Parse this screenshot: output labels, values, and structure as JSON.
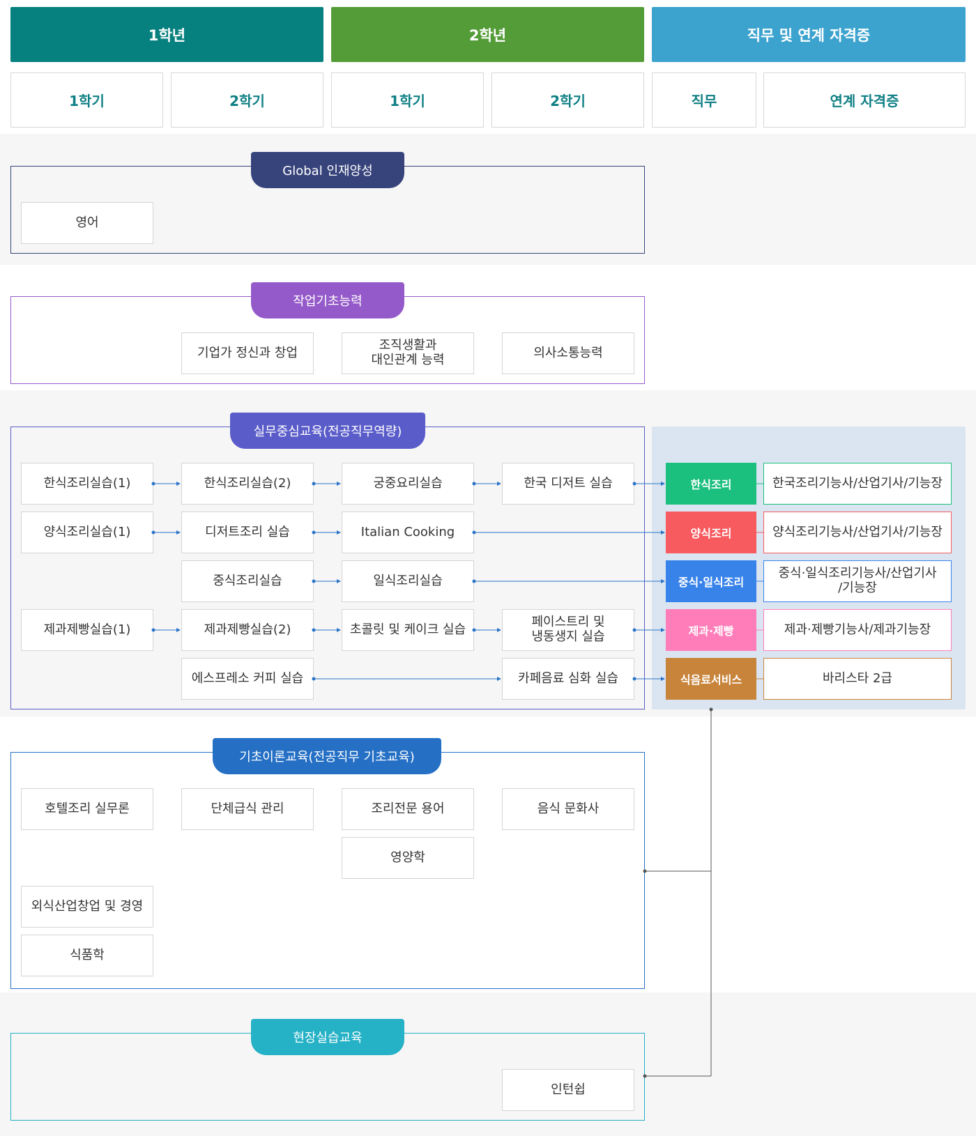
{
  "colors": {
    "year1": "#07817f",
    "year2": "#549c38",
    "jobs_header": "#3ca3cf",
    "global": "#37447b",
    "basic_ability": "#955ac9",
    "practical": "#5a5cc9",
    "theory": "#2570c5",
    "field": "#25b1c6",
    "korean": "#1bbf7e",
    "western": "#f75a5f",
    "chinese_japanese": "#3883ea",
    "bakery": "#ff7eb9",
    "food_service": "#c8843b",
    "jobs_panel": "#dbe4f1",
    "connector": "#2a74c9"
  },
  "headers": {
    "year1": "1학년",
    "year2": "2학년",
    "jobs": "직무 및 연계 자격증"
  },
  "subheaders": {
    "y1_sem1": "1학기",
    "y1_sem2": "2학기",
    "y2_sem1": "1학기",
    "y2_sem2": "2학기",
    "job": "직무",
    "cert": "연계 자격증"
  },
  "sections": {
    "global": {
      "title": "Global 인재양성",
      "courses": {
        "english": "영어"
      }
    },
    "basic_ability": {
      "title": "작업기초능력",
      "courses": {
        "entrepreneur": "기업가 정신과 창업",
        "organization": "조직생활과\n대인관계 능력",
        "communication": "의사소통능력"
      }
    },
    "practical": {
      "title": "실무중심교육(전공직무역량)",
      "courses": {
        "korean1": "한식조리실습(1)",
        "korean2": "한식조리실습(2)",
        "royal": "궁중요리실습",
        "korean_dessert": "한국 디저트 실습",
        "western1": "양식조리실습(1)",
        "dessert_cooking": "디저트조리 실습",
        "italian": "Italian Cooking",
        "chinese": "중식조리실습",
        "japanese": "일식조리실습",
        "bakery1": "제과제빵실습(1)",
        "bakery2": "제과제빵실습(2)",
        "chocolate": "초콜릿 및 케이크 실습",
        "pastry": "페이스트리 및\n냉동생지 실습",
        "espresso": "에스프레소 커피 실습",
        "cafe": "카페음료 심화 실습"
      }
    },
    "theory": {
      "title": "기초이론교육(전공직무 기초교육)",
      "courses": {
        "hotel": "호텔조리 실무론",
        "group_meal": "단체급식 관리",
        "terminology": "조리전문 용어",
        "food_culture": "음식 문화사",
        "nutrition": "영양학",
        "startup": "외식산업창업 및 경영",
        "food_science": "식품학"
      }
    },
    "field": {
      "title": "현장실습교육",
      "courses": {
        "intern": "인턴쉽"
      }
    }
  },
  "jobs": [
    {
      "name": "한식조리",
      "cert": "한국조리기능사/산업기사/기능장",
      "color_key": "korean"
    },
    {
      "name": "양식조리",
      "cert": "양식조리기능사/산업기사/기능장",
      "color_key": "western"
    },
    {
      "name": "중식·일식조리",
      "cert": "중식·일식조리기능사/산업기사\n/기능장",
      "color_key": "chinese_japanese"
    },
    {
      "name": "제과·제빵",
      "cert": "제과·제빵기능사/제과기능장",
      "color_key": "bakery"
    },
    {
      "name": "식음료서비스",
      "cert": "바리스타 2급",
      "color_key": "food_service"
    }
  ]
}
